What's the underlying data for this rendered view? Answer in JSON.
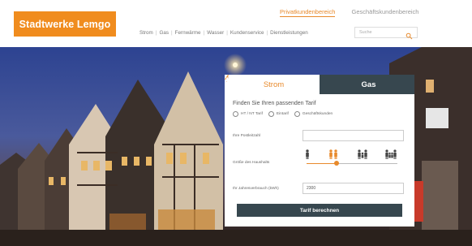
{
  "header": {
    "logo_text": "Stadtwerke Lemgo",
    "segments": [
      {
        "label": "Privatkundenbereich",
        "active": true
      },
      {
        "label": "Geschäftskundenbereich",
        "active": false
      }
    ],
    "nav": [
      "Strom",
      "Gas",
      "Fernwärme",
      "Wasser",
      "Kundenservice",
      "Dienstleistungen"
    ],
    "search_placeholder": "Suche"
  },
  "calculator": {
    "tabs": [
      {
        "label": "Strom",
        "active": true
      },
      {
        "label": "Gas",
        "active": false
      }
    ],
    "title": "Finden Sie Ihren passenden Tarif",
    "tariff_options": [
      {
        "label": "HT / NT Tarif",
        "selected": false
      },
      {
        "label": "Eintarif",
        "selected": false
      },
      {
        "label": "Geschäftskunden",
        "selected": false
      }
    ],
    "postcode_label": "Ihre Postleitzahl",
    "postcode_value": "",
    "household_label": "Größe des Haushalts",
    "household_selected": 2,
    "household_options": 4,
    "consumption_label": "Ihr Jahresverbrauch (kWh)",
    "consumption_value": "2300",
    "submit_label": "Tarif berechnen"
  },
  "colors": {
    "brand_orange": "#f08c1e",
    "dark_slate": "#37474f"
  }
}
